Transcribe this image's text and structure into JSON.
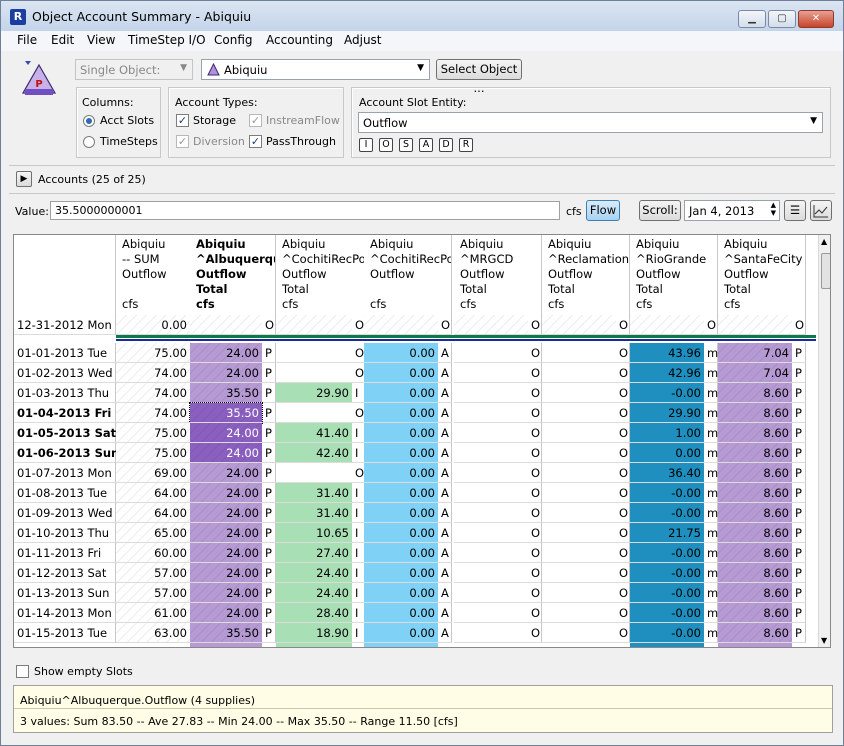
{
  "window": {
    "title": "Object Account Summary - Abiquiu",
    "app_icon_letter": "R",
    "min": "▁",
    "max": "▢",
    "close": "✕"
  },
  "menu": [
    "File",
    "Edit",
    "View",
    "TimeStep I/O",
    "Config",
    "Accounting",
    "Adjust"
  ],
  "toolbar": {
    "single_object": "Single Object:",
    "object_name": "Abiquiu",
    "select_object": "Select Object ...",
    "columns_label": "Columns:",
    "col_acct_slots": "Acct Slots",
    "col_timesteps": "TimeSteps",
    "types_label": "Account Types:",
    "type_storage": "Storage",
    "type_instream": "InstreamFlow",
    "type_diversion": "Diversion",
    "type_passthrough": "PassThrough",
    "entity_label": "Account Slot Entity:",
    "entity_value": "Outflow",
    "entity_buttons": [
      "I",
      "O",
      "S",
      "A",
      "D",
      "R"
    ]
  },
  "accounts": {
    "label": "Accounts (25 of 25)"
  },
  "valuebar": {
    "label": "Value:",
    "value": "35.5000000001",
    "unit": "cfs",
    "flow": "Flow",
    "scroll": "Scroll:",
    "date": "Jan 4, 2013"
  },
  "columns": [
    {
      "lines": [
        "Abiquiu",
        "-- SUM",
        "Outflow",
        "",
        "cfs"
      ],
      "bold": false
    },
    {
      "lines": [
        "Abiquiu",
        "^Albuquerque",
        "Outflow",
        "Total",
        "cfs"
      ],
      "bold": true
    },
    {
      "lines": [
        "Abiquiu",
        "^CochitiRecPool",
        "Outflow",
        "Total",
        "cfs"
      ],
      "bold": false
    },
    {
      "lines": [
        "Abiquiu",
        "^CochitiRecPool",
        "Outflow",
        "",
        "cfs"
      ],
      "bold": false
    },
    {
      "lines": [
        "Abiquiu",
        "^MRGCD",
        "Outflow",
        "Total",
        "cfs"
      ],
      "bold": false
    },
    {
      "lines": [
        "Abiquiu",
        "^Reclamation",
        "Outflow",
        "Total",
        "cfs"
      ],
      "bold": false
    },
    {
      "lines": [
        "Abiquiu",
        "^RioGrande",
        "Outflow",
        "Total",
        "cfs"
      ],
      "bold": false
    },
    {
      "lines": [
        "Abiquiu",
        "^SantaFeCity",
        "Outflow",
        "Total",
        "cfs"
      ],
      "bold": false
    }
  ],
  "initial_row": {
    "date": "12-31-2012 Mon",
    "values": [
      "0.00",
      "",
      "",
      "",
      "",
      "",
      "",
      ""
    ],
    "flags": [
      "",
      "O",
      "O",
      "O",
      "O",
      "O",
      "O",
      "O"
    ]
  },
  "rows": [
    {
      "date": "01-01-2013 Tue",
      "bold": false,
      "v": [
        "75.00",
        "24.00",
        "",
        "0.00",
        "",
        "",
        "43.96",
        "7.04"
      ],
      "f": [
        "",
        "P",
        "O",
        "A",
        "O",
        "O",
        "m",
        "P"
      ]
    },
    {
      "date": "01-02-2013 Wed",
      "bold": false,
      "v": [
        "74.00",
        "24.00",
        "",
        "0.00",
        "",
        "",
        "42.96",
        "7.04"
      ],
      "f": [
        "",
        "P",
        "O",
        "A",
        "O",
        "O",
        "m",
        "P"
      ]
    },
    {
      "date": "01-03-2013 Thu",
      "bold": false,
      "v": [
        "74.00",
        "35.50",
        "29.90",
        "0.00",
        "",
        "",
        "-0.00",
        "8.60"
      ],
      "f": [
        "",
        "P",
        "I",
        "A",
        "O",
        "O",
        "m",
        "P"
      ]
    },
    {
      "date": "01-04-2013 Fri",
      "bold": true,
      "v": [
        "74.00",
        "35.50",
        "",
        "0.00",
        "",
        "",
        "29.90",
        "8.60"
      ],
      "f": [
        "",
        "P",
        "O",
        "A",
        "O",
        "O",
        "m",
        "P"
      ]
    },
    {
      "date": "01-05-2013 Sat",
      "bold": true,
      "v": [
        "75.00",
        "24.00",
        "41.40",
        "0.00",
        "",
        "",
        "1.00",
        "8.60"
      ],
      "f": [
        "",
        "P",
        "I",
        "A",
        "O",
        "O",
        "m",
        "P"
      ]
    },
    {
      "date": "01-06-2013 Sun",
      "bold": true,
      "v": [
        "75.00",
        "24.00",
        "42.40",
        "0.00",
        "",
        "",
        "0.00",
        "8.60"
      ],
      "f": [
        "",
        "P",
        "I",
        "A",
        "O",
        "O",
        "m",
        "P"
      ]
    },
    {
      "date": "01-07-2013 Mon",
      "bold": false,
      "v": [
        "69.00",
        "24.00",
        "",
        "0.00",
        "",
        "",
        "36.40",
        "8.60"
      ],
      "f": [
        "",
        "P",
        "O",
        "A",
        "O",
        "O",
        "m",
        "P"
      ]
    },
    {
      "date": "01-08-2013 Tue",
      "bold": false,
      "v": [
        "64.00",
        "24.00",
        "31.40",
        "0.00",
        "",
        "",
        "-0.00",
        "8.60"
      ],
      "f": [
        "",
        "P",
        "I",
        "A",
        "O",
        "O",
        "m",
        "P"
      ]
    },
    {
      "date": "01-09-2013 Wed",
      "bold": false,
      "v": [
        "64.00",
        "24.00",
        "31.40",
        "0.00",
        "",
        "",
        "-0.00",
        "8.60"
      ],
      "f": [
        "",
        "P",
        "I",
        "A",
        "O",
        "O",
        "m",
        "P"
      ]
    },
    {
      "date": "01-10-2013 Thu",
      "bold": false,
      "v": [
        "65.00",
        "24.00",
        "10.65",
        "0.00",
        "",
        "",
        "21.75",
        "8.60"
      ],
      "f": [
        "",
        "P",
        "I",
        "A",
        "O",
        "O",
        "m",
        "P"
      ]
    },
    {
      "date": "01-11-2013 Fri",
      "bold": false,
      "v": [
        "60.00",
        "24.00",
        "27.40",
        "0.00",
        "",
        "",
        "-0.00",
        "8.60"
      ],
      "f": [
        "",
        "P",
        "I",
        "A",
        "O",
        "O",
        "m",
        "P"
      ]
    },
    {
      "date": "01-12-2013 Sat",
      "bold": false,
      "v": [
        "57.00",
        "24.00",
        "24.40",
        "0.00",
        "",
        "",
        "-0.00",
        "8.60"
      ],
      "f": [
        "",
        "P",
        "I",
        "A",
        "O",
        "O",
        "m",
        "P"
      ]
    },
    {
      "date": "01-13-2013 Sun",
      "bold": false,
      "v": [
        "57.00",
        "24.00",
        "24.40",
        "0.00",
        "",
        "",
        "-0.00",
        "8.60"
      ],
      "f": [
        "",
        "P",
        "I",
        "A",
        "O",
        "O",
        "m",
        "P"
      ]
    },
    {
      "date": "01-14-2013 Mon",
      "bold": false,
      "v": [
        "61.00",
        "24.00",
        "28.40",
        "0.00",
        "",
        "",
        "-0.00",
        "8.60"
      ],
      "f": [
        "",
        "P",
        "I",
        "A",
        "O",
        "O",
        "m",
        "P"
      ]
    },
    {
      "date": "01-15-2013 Tue",
      "bold": false,
      "v": [
        "63.00",
        "35.50",
        "18.90",
        "0.00",
        "",
        "",
        "-0.00",
        "8.60"
      ],
      "f": [
        "",
        "P",
        "I",
        "A",
        "O",
        "O",
        "m",
        "P"
      ]
    }
  ],
  "footer": {
    "show_empty": "Show empty Slots",
    "status_line1": "Abiquiu^Albuquerque.Outflow (4 supplies)",
    "status_line2": "3 values:  Sum 83.50 -- Ave 27.83 -- Min 24.00 -- Max 35.50 -- Range 11.50 [cfs]"
  },
  "colors": {
    "purple": "#b69ad3",
    "purple_dark": "#8a5fc0",
    "green": "#a8dfb5",
    "blue": "#7fd2f5",
    "teal": "#1e8fbf"
  }
}
